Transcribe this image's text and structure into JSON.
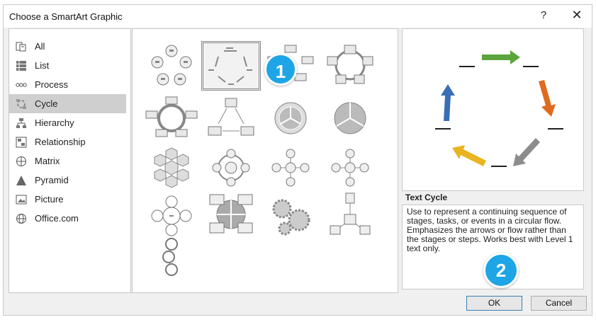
{
  "dialog": {
    "title": "Choose a SmartArt Graphic",
    "help_label": "?",
    "close_label": "✕"
  },
  "categories": [
    {
      "label": "All",
      "icon": "all-icon"
    },
    {
      "label": "List",
      "icon": "list-icon"
    },
    {
      "label": "Process",
      "icon": "process-icon"
    },
    {
      "label": "Cycle",
      "icon": "cycle-icon",
      "selected": true
    },
    {
      "label": "Hierarchy",
      "icon": "hierarchy-icon"
    },
    {
      "label": "Relationship",
      "icon": "relationship-icon"
    },
    {
      "label": "Matrix",
      "icon": "matrix-icon"
    },
    {
      "label": "Pyramid",
      "icon": "pyramid-icon"
    },
    {
      "label": "Picture",
      "icon": "picture-icon"
    },
    {
      "label": "Office.com",
      "icon": "globe-icon"
    }
  ],
  "gallery": {
    "selected": "Text Cycle"
  },
  "preview": {
    "title": "Text Cycle",
    "description": "Use to represent a continuing sequence of stages, tasks, or events in a circular flow. Emphasizes the arrows or flow rather than the stages or steps. Works best with Level 1 text only.",
    "arrow_colors": [
      "#5aa63c",
      "#e06a1e",
      "#8c8c8c",
      "#e8b420",
      "#3a6fb5"
    ]
  },
  "buttons": {
    "ok": "OK",
    "cancel": "Cancel"
  },
  "badges": [
    "1",
    "2"
  ]
}
